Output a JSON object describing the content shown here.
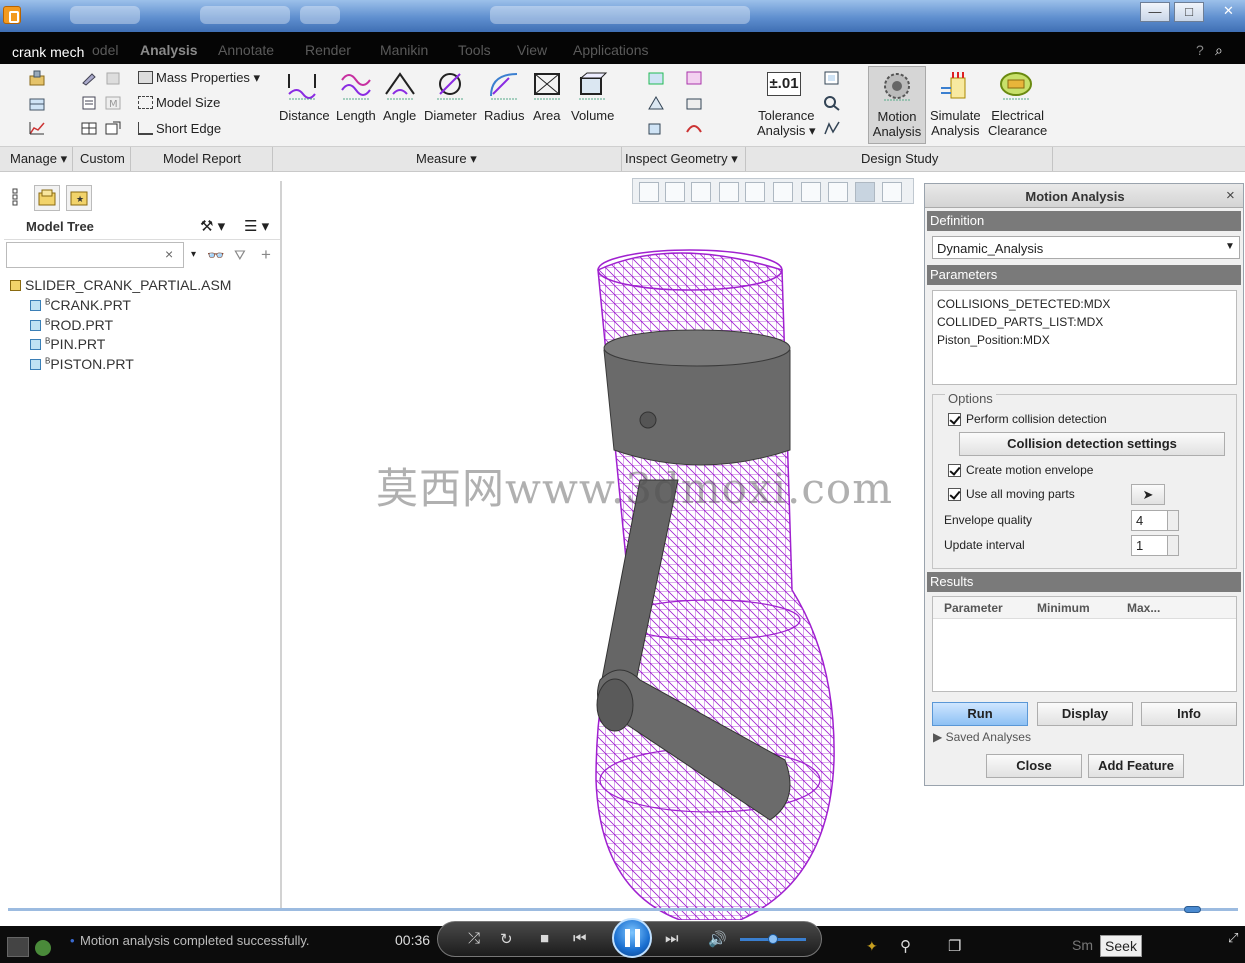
{
  "window": {
    "min_label": "—",
    "max_label": "□",
    "close_label": "✕"
  },
  "overlay_title": "crank mech",
  "menu": {
    "tabs": [
      {
        "label": "odel"
      },
      {
        "label": "Analysis"
      },
      {
        "label": "Annotate"
      },
      {
        "label": "Render"
      },
      {
        "label": "Manikin"
      },
      {
        "label": "Tools"
      },
      {
        "label": "View"
      },
      {
        "label": "Applications"
      }
    ]
  },
  "ribbon": {
    "model_report": {
      "mass_properties": "Mass Properties",
      "model_size": "Model Size",
      "short_edge": "Short Edge"
    },
    "measure": {
      "distance": "Distance",
      "length": "Length",
      "angle": "Angle",
      "diameter": "Diameter",
      "radius": "Radius",
      "area": "Area",
      "volume": "Volume"
    },
    "tolerance": {
      "line1": "Tolerance",
      "line2": "Analysis",
      "icon_text": "±.01"
    },
    "design_study": {
      "motion": {
        "line1": "Motion",
        "line2": "Analysis"
      },
      "simulate": {
        "line1": "Simulate",
        "line2": "Analysis"
      },
      "electrical": {
        "line1": "Electrical",
        "line2": "Clearance"
      }
    },
    "groups": {
      "manage": "Manage",
      "custom": "Custom",
      "model_report": "Model Report",
      "measure": "Measure",
      "inspect_geometry": "Inspect Geometry",
      "design_study": "Design Study"
    }
  },
  "model_tree": {
    "title": "Model Tree",
    "filter_clear": "×",
    "items": [
      {
        "label": "SLIDER_CRANK_PARTIAL.ASM"
      },
      {
        "label": "CRANK.PRT"
      },
      {
        "label": "ROD.PRT"
      },
      {
        "label": "PIN.PRT"
      },
      {
        "label": "PISTON.PRT"
      }
    ]
  },
  "watermark": "莫西网www.3dmoxi.com",
  "dialog": {
    "title": "Motion Analysis",
    "close": "×",
    "definition_label": "Definition",
    "definition_value": "Dynamic_Analysis",
    "parameters_label": "Parameters",
    "parameters": [
      {
        "label": "COLLISIONS_DETECTED:MDX"
      },
      {
        "label": "COLLIDED_PARTS_LIST:MDX"
      },
      {
        "label": "Piston_Position:MDX"
      }
    ],
    "options_label": "Options",
    "perform_collision": "Perform collision detection",
    "collision_settings": "Collision detection settings",
    "create_envelope": "Create motion envelope",
    "use_all_parts": "Use all moving parts",
    "envelope_quality_label": "Envelope quality",
    "envelope_quality_value": "4",
    "update_interval_label": "Update interval",
    "update_interval_value": "1",
    "results_label": "Results",
    "results_columns": [
      {
        "label": "Parameter"
      },
      {
        "label": "Minimum"
      },
      {
        "label": "Max..."
      }
    ],
    "run": "Run",
    "display": "Display",
    "info": "Info",
    "saved_analyses": "Saved Analyses",
    "close_button": "Close",
    "add_feature": "Add Feature"
  },
  "status": {
    "message": "Motion analysis completed successfully.",
    "time": "00:36",
    "smart": "Sm",
    "seek": "Seek"
  },
  "colors": {
    "wireframe": "#a020d0",
    "piston": "#6a6a6a",
    "accent": "#4a90d9"
  }
}
